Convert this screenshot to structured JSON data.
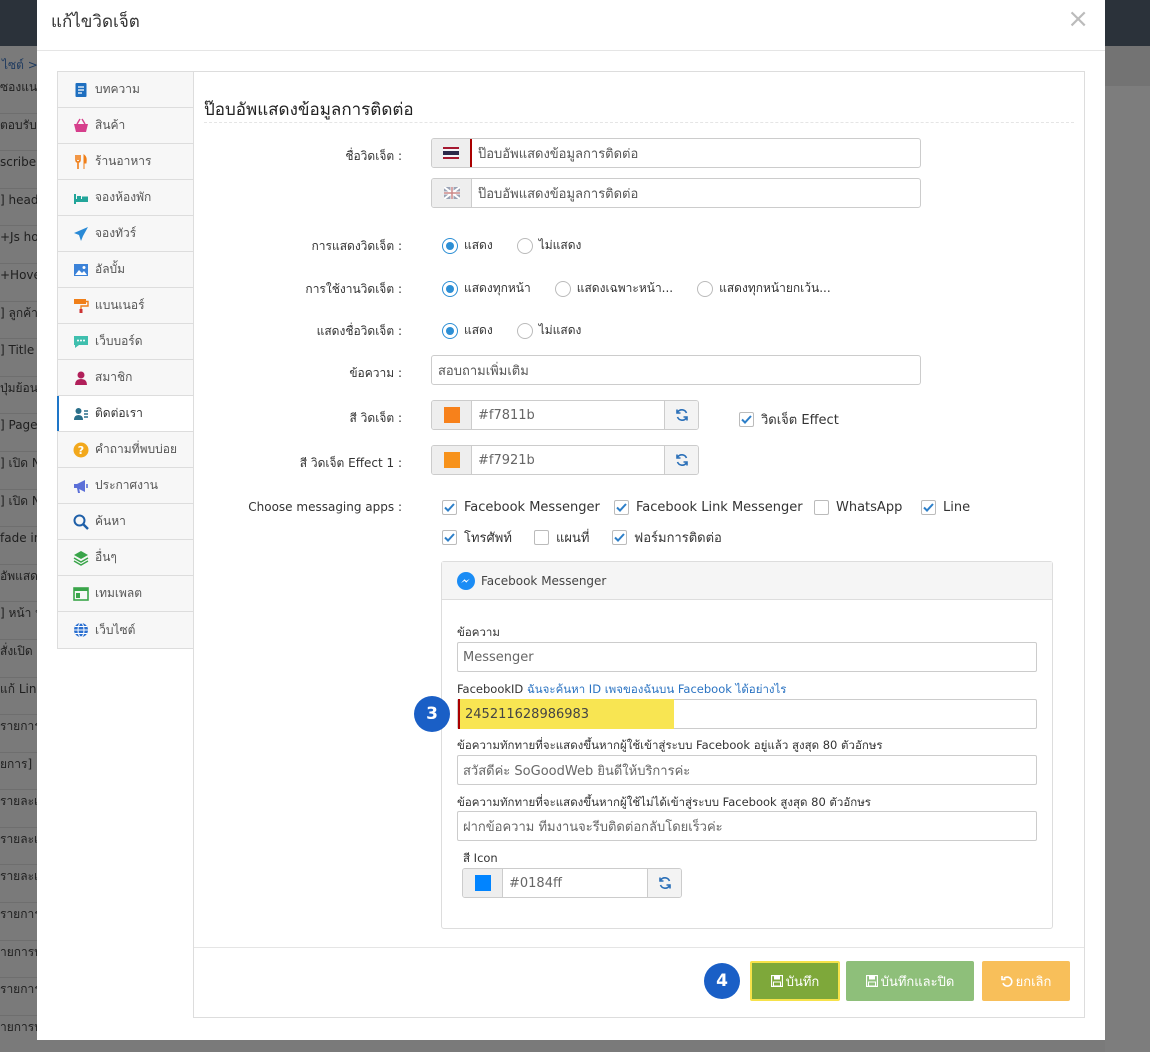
{
  "background": {
    "breadcrumb": "ไซต์ >",
    "rows": [
      "ซองแนะ",
      "ตอบรับ",
      "scribe",
      "] heade",
      "+Js hov",
      "+Hover",
      "] ลูกค้า",
      "] Title t",
      "ปุ่มย้อน",
      "] Page",
      "] เปิด N",
      "] เปิด N",
      "fade in",
      "อัพแสด",
      "] หน้า ห",
      "สั่งเปิด",
      "แก้ Link",
      "รายการ",
      "ยการ]",
      "รายละเ",
      "รายละเอีย",
      "รายละเ",
      "รายการ",
      "ายการท",
      "รายการ",
      "ายการท"
    ]
  },
  "modal": {
    "title": "แก้ไขวิดเจ็ต",
    "close_glyph": "×"
  },
  "sidebar": {
    "items": [
      {
        "label": "บทความ",
        "icon": "document-icon",
        "color": "#1e6fc0"
      },
      {
        "label": "สินค้า",
        "icon": "basket-icon",
        "color": "#d63f8c"
      },
      {
        "label": "ร้านอาหาร",
        "icon": "fork-knife-icon",
        "color": "#f07f19"
      },
      {
        "label": "จองห้องพัก",
        "icon": "bed-icon",
        "color": "#22a59a"
      },
      {
        "label": "จองทัวร์",
        "icon": "plane-icon",
        "color": "#2a8ad6"
      },
      {
        "label": "อัลบั้ม",
        "icon": "image-icon",
        "color": "#3b82d8"
      },
      {
        "label": "แบนเนอร์",
        "icon": "paint-roller-icon",
        "color": "#f07f19"
      },
      {
        "label": "เว็บบอร์ด",
        "icon": "chat-icon",
        "color": "#3fbfae"
      },
      {
        "label": "สมาชิก",
        "icon": "user-icon",
        "color": "#b1205a"
      },
      {
        "label": "ติดต่อเรา",
        "icon": "contact-icon",
        "color": "#2a6f8a"
      },
      {
        "label": "คำถามที่พบบ่อย",
        "icon": "question-icon",
        "color": "#f2a81c"
      },
      {
        "label": "ประกาศงาน",
        "icon": "megaphone-icon",
        "color": "#5b6fd8"
      },
      {
        "label": "ค้นหา",
        "icon": "search-icon",
        "color": "#1e5fa8"
      },
      {
        "label": "อื่นๆ",
        "icon": "layers-icon",
        "color": "#3aa54a"
      },
      {
        "label": "เทมเพลต",
        "icon": "template-icon",
        "color": "#3aa54a"
      },
      {
        "label": "เว็บไซต์",
        "icon": "globe-icon",
        "color": "#2a6fd0"
      }
    ]
  },
  "form": {
    "title": "ป๊อบอัพแสดงข้อมูลการติดต่อ",
    "widget_name_label": "ชื่อวิดเจ็ต :",
    "widget_name_th": "ป๊อบอัพแสดงข้อมูลการติดต่อ",
    "widget_name_en": "ป๊อบอัพแสดงข้อมูลการติดต่อ",
    "display_label": "การแสดงวิดเจ็ต :",
    "display_options": [
      "แสดง",
      "ไม่แสดง"
    ],
    "usage_label": "การใช้งานวิดเจ็ต :",
    "usage_options": [
      "แสดงทุกหน้า",
      "แสดงเฉพาะหน้า...",
      "แสดงทุกหน้ายกเว้น..."
    ],
    "show_name_label": "แสดงชื่อวิดเจ็ต :",
    "show_name_options": [
      "แสดง",
      "ไม่แสดง"
    ],
    "message_label": "ข้อความ :",
    "message_value": "สอบถามเพิ่มเติม",
    "color_label": "สี วิดเจ็ต :",
    "color_value": "#f7811b",
    "effect_checkbox": "วิดเจ็ต Effect",
    "color_effect_label": "สี วิดเจ็ต Effect 1 :",
    "color_effect_value": "#f7921b",
    "apps_label": "Choose messaging apps :",
    "apps": [
      {
        "label": "Facebook Messenger",
        "checked": true
      },
      {
        "label": "Facebook Link Messenger",
        "checked": true
      },
      {
        "label": "WhatsApp",
        "checked": false
      },
      {
        "label": "Line",
        "checked": true
      },
      {
        "label": "โทรศัพท์",
        "checked": true
      },
      {
        "label": "แผนที่",
        "checked": false
      },
      {
        "label": "ฟอร์มการติดต่อ",
        "checked": true
      }
    ]
  },
  "messenger": {
    "header": "Facebook Messenger",
    "message_label": "ข้อความ",
    "message_value": "Messenger",
    "fbid_label": "FacebookID",
    "fbid_link": "ฉันจะค้นหา ID เพจของฉันบน Facebook ได้อย่างไร",
    "fbid_value": "245211628986983",
    "greet_in_label": "ข้อความทักทายที่จะแสดงขึ้นหากผู้ใช้เข้าสู่ระบบ Facebook อยู่แล้ว สูงสุด 80 ตัวอักษร",
    "greet_in_value": "สวัสดีค่ะ SoGoodWeb ยินดีให้บริการค่ะ",
    "greet_out_label": "ข้อความทักทายที่จะแสดงขึ้นหากผู้ใช้ไม่ได้เข้าสู่ระบบ Facebook สูงสุด 80 ตัวอักษร",
    "greet_out_value": "ฝากข้อความ ทีมงานจะรีบติดต่อกลับโดยเร็วค่ะ",
    "icon_color_label": "สี Icon",
    "icon_color_value": "#0184ff"
  },
  "badges": {
    "step3": "3",
    "step4": "4"
  },
  "footer": {
    "save": "บันทึก",
    "save_close": "บันทึกและปิด",
    "cancel": "ยกเลิก"
  }
}
